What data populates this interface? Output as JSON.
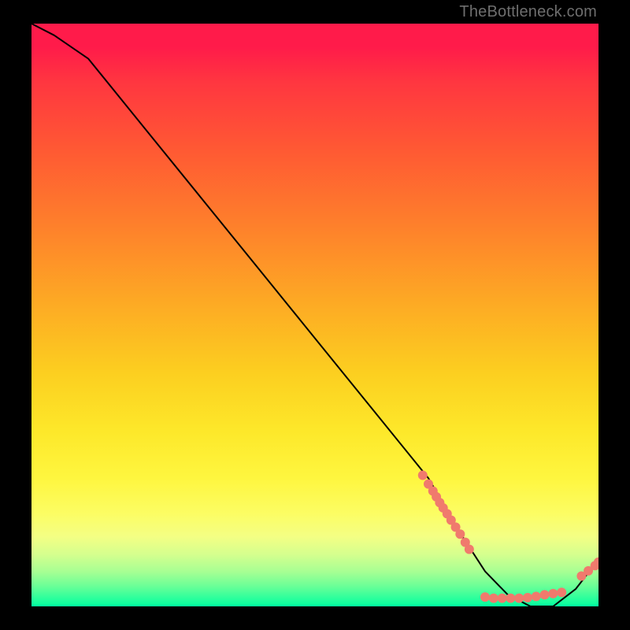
{
  "attribution": "TheBottleneck.com",
  "chart_data": {
    "type": "line",
    "title": "",
    "xlabel": "",
    "ylabel": "",
    "xlim": [
      0,
      100
    ],
    "ylim": [
      0,
      100
    ],
    "grid": false,
    "legend": false,
    "series": [
      {
        "name": "curve",
        "style": "line",
        "color": "#000000",
        "x": [
          0,
          4,
          10,
          20,
          30,
          40,
          50,
          60,
          70,
          76,
          80,
          84,
          88,
          92,
          96,
          100
        ],
        "values": [
          100,
          98,
          94,
          82,
          70,
          58,
          46,
          34,
          22,
          12,
          6,
          2,
          0,
          0,
          3,
          8
        ]
      },
      {
        "name": "points-descent",
        "style": "marker",
        "color": "#f07a6d",
        "x": [
          69.0,
          70.0,
          70.8,
          71.4,
          72.0,
          72.6,
          73.3,
          74.0,
          74.8,
          75.6,
          76.5,
          77.2
        ],
        "values": [
          22.5,
          21.0,
          19.8,
          18.8,
          17.8,
          16.9,
          15.9,
          14.8,
          13.6,
          12.4,
          11.0,
          9.8
        ]
      },
      {
        "name": "points-valley",
        "style": "marker",
        "color": "#f07a6d",
        "x": [
          80.0,
          81.5,
          83.0,
          84.5,
          86.0,
          87.5,
          89.0,
          90.5,
          92.0,
          93.5
        ],
        "values": [
          1.6,
          1.4,
          1.4,
          1.4,
          1.4,
          1.5,
          1.7,
          2.0,
          2.2,
          2.4
        ]
      },
      {
        "name": "points-rise",
        "style": "marker",
        "color": "#f07a6d",
        "x": [
          97.0,
          98.2,
          99.4,
          100.0
        ],
        "values": [
          5.2,
          6.1,
          7.0,
          7.6
        ]
      }
    ],
    "background_gradient": {
      "orientation": "vertical",
      "stops": [
        {
          "pos": 0.0,
          "color": "#ff1b4a"
        },
        {
          "pos": 0.04,
          "color": "#ff1b4a"
        },
        {
          "pos": 0.1,
          "color": "#ff3640"
        },
        {
          "pos": 0.22,
          "color": "#ff5a33"
        },
        {
          "pos": 0.35,
          "color": "#fe812b"
        },
        {
          "pos": 0.48,
          "color": "#fdaa24"
        },
        {
          "pos": 0.6,
          "color": "#fccf20"
        },
        {
          "pos": 0.7,
          "color": "#fde82a"
        },
        {
          "pos": 0.78,
          "color": "#fef63f"
        },
        {
          "pos": 0.84,
          "color": "#fcfd63"
        },
        {
          "pos": 0.88,
          "color": "#f4ff84"
        },
        {
          "pos": 0.91,
          "color": "#d6ff8e"
        },
        {
          "pos": 0.94,
          "color": "#a8ff93"
        },
        {
          "pos": 0.965,
          "color": "#6bff97"
        },
        {
          "pos": 0.985,
          "color": "#2fff9c"
        },
        {
          "pos": 1.0,
          "color": "#00ff9f"
        }
      ]
    }
  }
}
